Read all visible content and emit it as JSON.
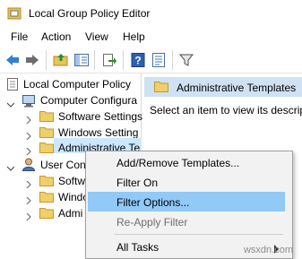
{
  "window": {
    "title": "Local Group Policy Editor",
    "app_icon": "group-policy-icon"
  },
  "menubar": {
    "items": [
      "File",
      "Action",
      "View",
      "Help"
    ]
  },
  "toolbar": {
    "buttons": [
      "back-icon",
      "forward-icon",
      "up-folder-icon",
      "show-hide-tree-icon",
      "export-list-icon",
      "help-icon",
      "properties-icon",
      "filter-icon"
    ]
  },
  "tree": {
    "root": "Local Computer Policy",
    "computer_config": "Computer Configura",
    "software_settings": "Software Settings",
    "windows_settings": "Windows Setting",
    "admin_templates": "Administrative Te",
    "user_config": "User Con",
    "user_software": "Softw",
    "user_windows": "Windo",
    "user_admin": "Admi"
  },
  "right": {
    "header": "Administrative Templates",
    "message": "Select an item to view its descrip"
  },
  "context_menu": {
    "items": [
      {
        "label": "Add/Remove Templates...",
        "enabled": true
      },
      {
        "label": "Filter On",
        "enabled": true
      },
      {
        "label": "Filter Options...",
        "enabled": true,
        "highlighted": true
      },
      {
        "label": "Re-Apply Filter",
        "enabled": false
      },
      {
        "label": "All Tasks",
        "enabled": true,
        "submenu": true
      }
    ]
  },
  "watermark": "wsxdn.com",
  "colors": {
    "selection": "#cce8ff",
    "menu_highlight": "#91c9f7",
    "header_bg": "#cfe2f3",
    "folder": "#e8c35a"
  }
}
